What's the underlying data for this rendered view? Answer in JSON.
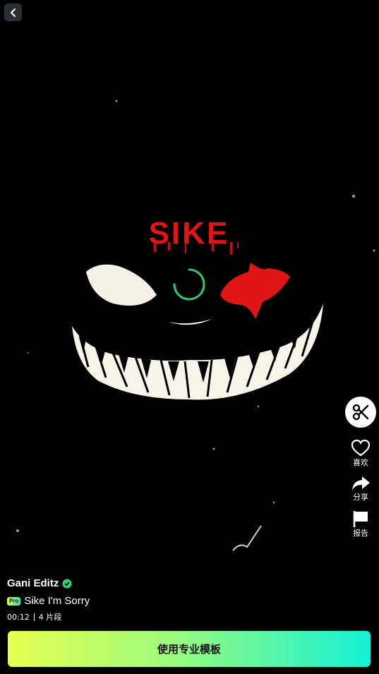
{
  "video": {
    "artwork_text": "SIKE",
    "colors": {
      "accent_red": "#e01515",
      "spinner": "#2fc86a"
    }
  },
  "nav": {
    "back_icon": "chevron-left-icon"
  },
  "side_actions": {
    "cut_icon": "scissors-icon",
    "like": {
      "label": "喜欢",
      "icon": "heart-icon"
    },
    "share": {
      "label": "分享",
      "icon": "share-arrow-icon"
    },
    "report": {
      "label": "报告",
      "icon": "flag-icon"
    }
  },
  "author": {
    "name": "Gani Editz",
    "verified_icon": "verified-check-icon"
  },
  "template": {
    "pro_badge": "Pro",
    "title": "Sike I'm Sorry",
    "duration": "00:12",
    "segments": "4 片段"
  },
  "cta": {
    "label": "使用专业模板",
    "colors": [
      "#e6ff50",
      "#14f0d6"
    ]
  }
}
